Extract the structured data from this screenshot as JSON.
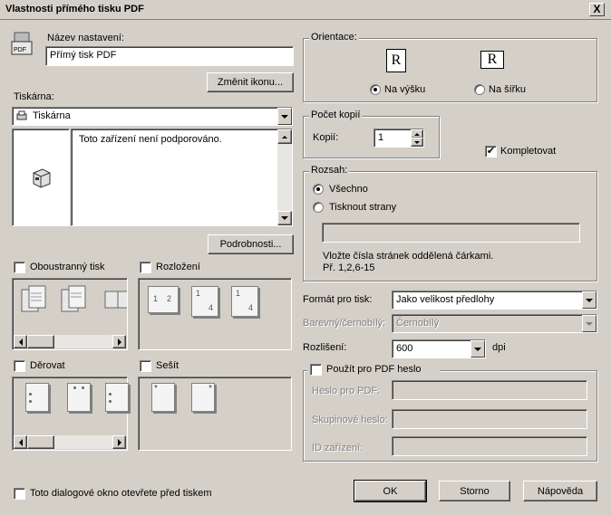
{
  "window": {
    "title": "Vlastnosti přímého tisku PDF",
    "close_glyph": "X"
  },
  "setting_name": {
    "label": "Název nastavení:",
    "value": "Přímý tisk PDF"
  },
  "change_icon_button": "Změnit ikonu...",
  "printer": {
    "label": "Tiskárna:",
    "selected": "Tiskárna",
    "status_text": "Toto zařízení není podporováno.",
    "details_button": "Podrobnosti..."
  },
  "duplex": {
    "label": "Oboustranný tisk",
    "checked": false
  },
  "layout": {
    "label": "Rozložení",
    "checked": false,
    "page_labels": [
      "1",
      "2",
      "1",
      "4",
      "1",
      "4"
    ]
  },
  "punch": {
    "label": "Děrovat",
    "checked": false
  },
  "staple": {
    "label": "Sešít",
    "checked": false,
    "staple_glyph": "*"
  },
  "orientation": {
    "legend": "Orientace:",
    "glyph": "R",
    "portrait": "Na výšku",
    "landscape": "Na šířku",
    "selected": "portrait"
  },
  "copies": {
    "legend": "Počet kopií",
    "label": "Kopií:",
    "value": "1"
  },
  "collate": {
    "label": "Kompletovat",
    "checked": true,
    "check_glyph": "✔"
  },
  "range": {
    "legend": "Rozsah:",
    "all": "Všechno",
    "pages": "Tisknout strany",
    "selected": "all",
    "pages_value": "",
    "hint": "Vložte čísla stránek oddělená čárkami.",
    "example": "Př. 1,2,6-15"
  },
  "print_format": {
    "label": "Formát pro tisk:",
    "value": "Jako velikost předlohy"
  },
  "color_mode": {
    "label": "Barevný/černobílý:",
    "value": "Černobílý"
  },
  "resolution": {
    "label": "Rozlišení:",
    "value": "600",
    "unit": "dpi"
  },
  "pdf_password": {
    "label": "Použít pro PDF heslo",
    "checked": false,
    "password_label": "Heslo pro PDF:",
    "group_label": "Skupinové heslo:",
    "device_id_label": "ID zařízení:"
  },
  "show_dialog": {
    "label": "Toto dialogové okno otevřete před tiskem",
    "checked": false
  },
  "buttons": {
    "ok": "OK",
    "cancel": "Storno",
    "help": "Nápověda"
  }
}
